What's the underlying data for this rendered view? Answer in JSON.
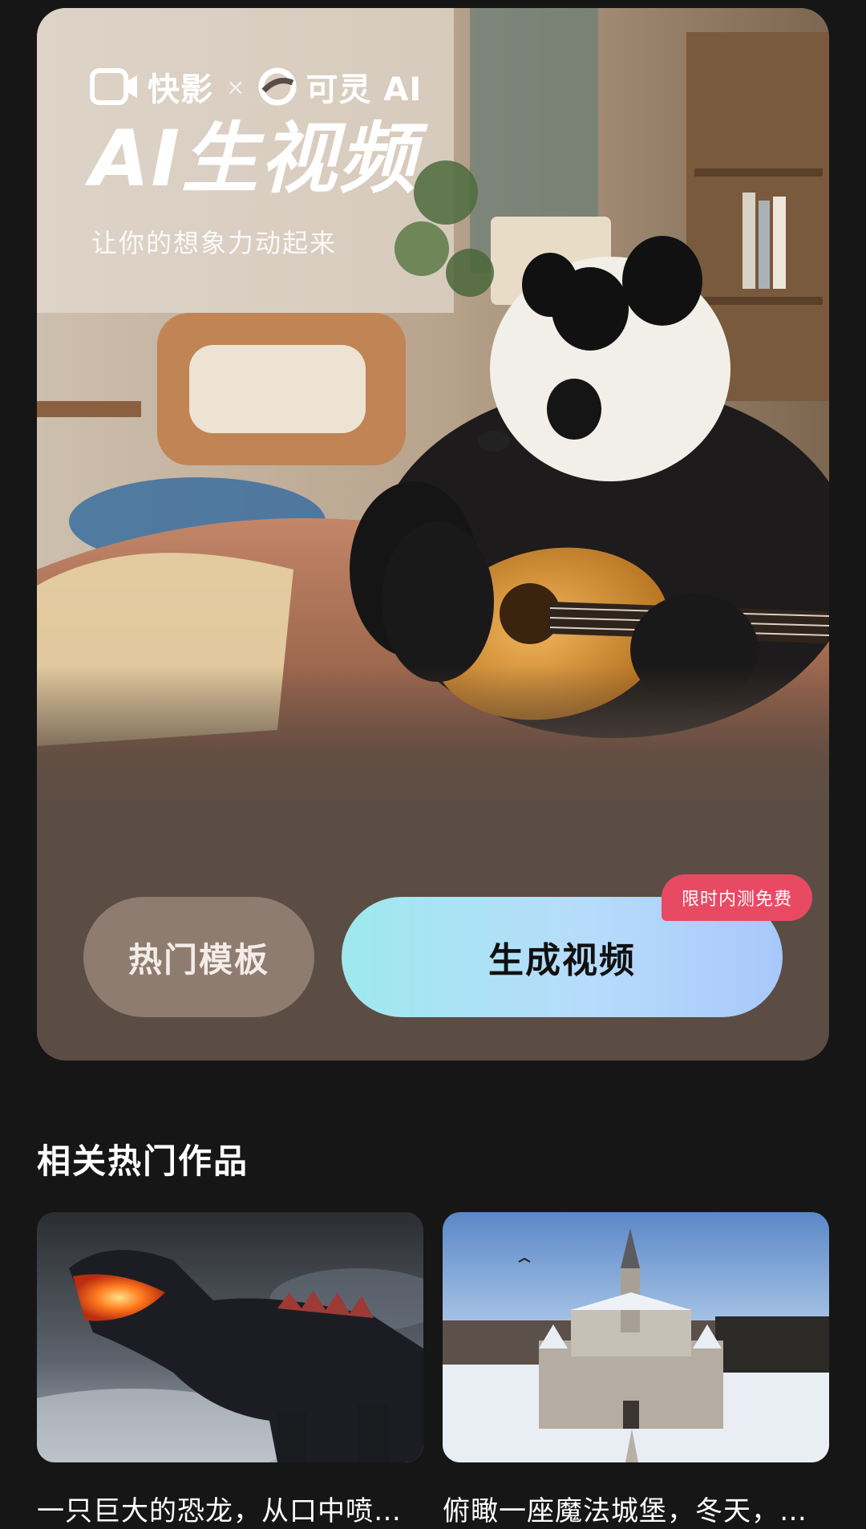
{
  "hero": {
    "brand_kuaiying": "快影",
    "brand_separator": "×",
    "brand_keling": "可灵 AI",
    "headline": "AI生视频",
    "subline": "让你的想象力动起来",
    "badge": "限时内测免费",
    "templates_label": "热门模板",
    "generate_label": "生成视频"
  },
  "related": {
    "title": "相关热门作品",
    "items": [
      {
        "caption": "一只巨大的恐龙，从口中喷…",
        "thumbnail": "dinosaur-breathing-fire"
      },
      {
        "caption": "俯瞰一座魔法城堡，冬天，…",
        "thumbnail": "snowy-castle-aerial"
      }
    ]
  },
  "colors": {
    "background": "#161616",
    "hero_bottom": "#5b4d44",
    "templates_button": "#8e7c70",
    "generate_gradient_start": "#9ee9ee",
    "generate_gradient_end": "#a8c8fb",
    "badge": "#e94a63"
  }
}
